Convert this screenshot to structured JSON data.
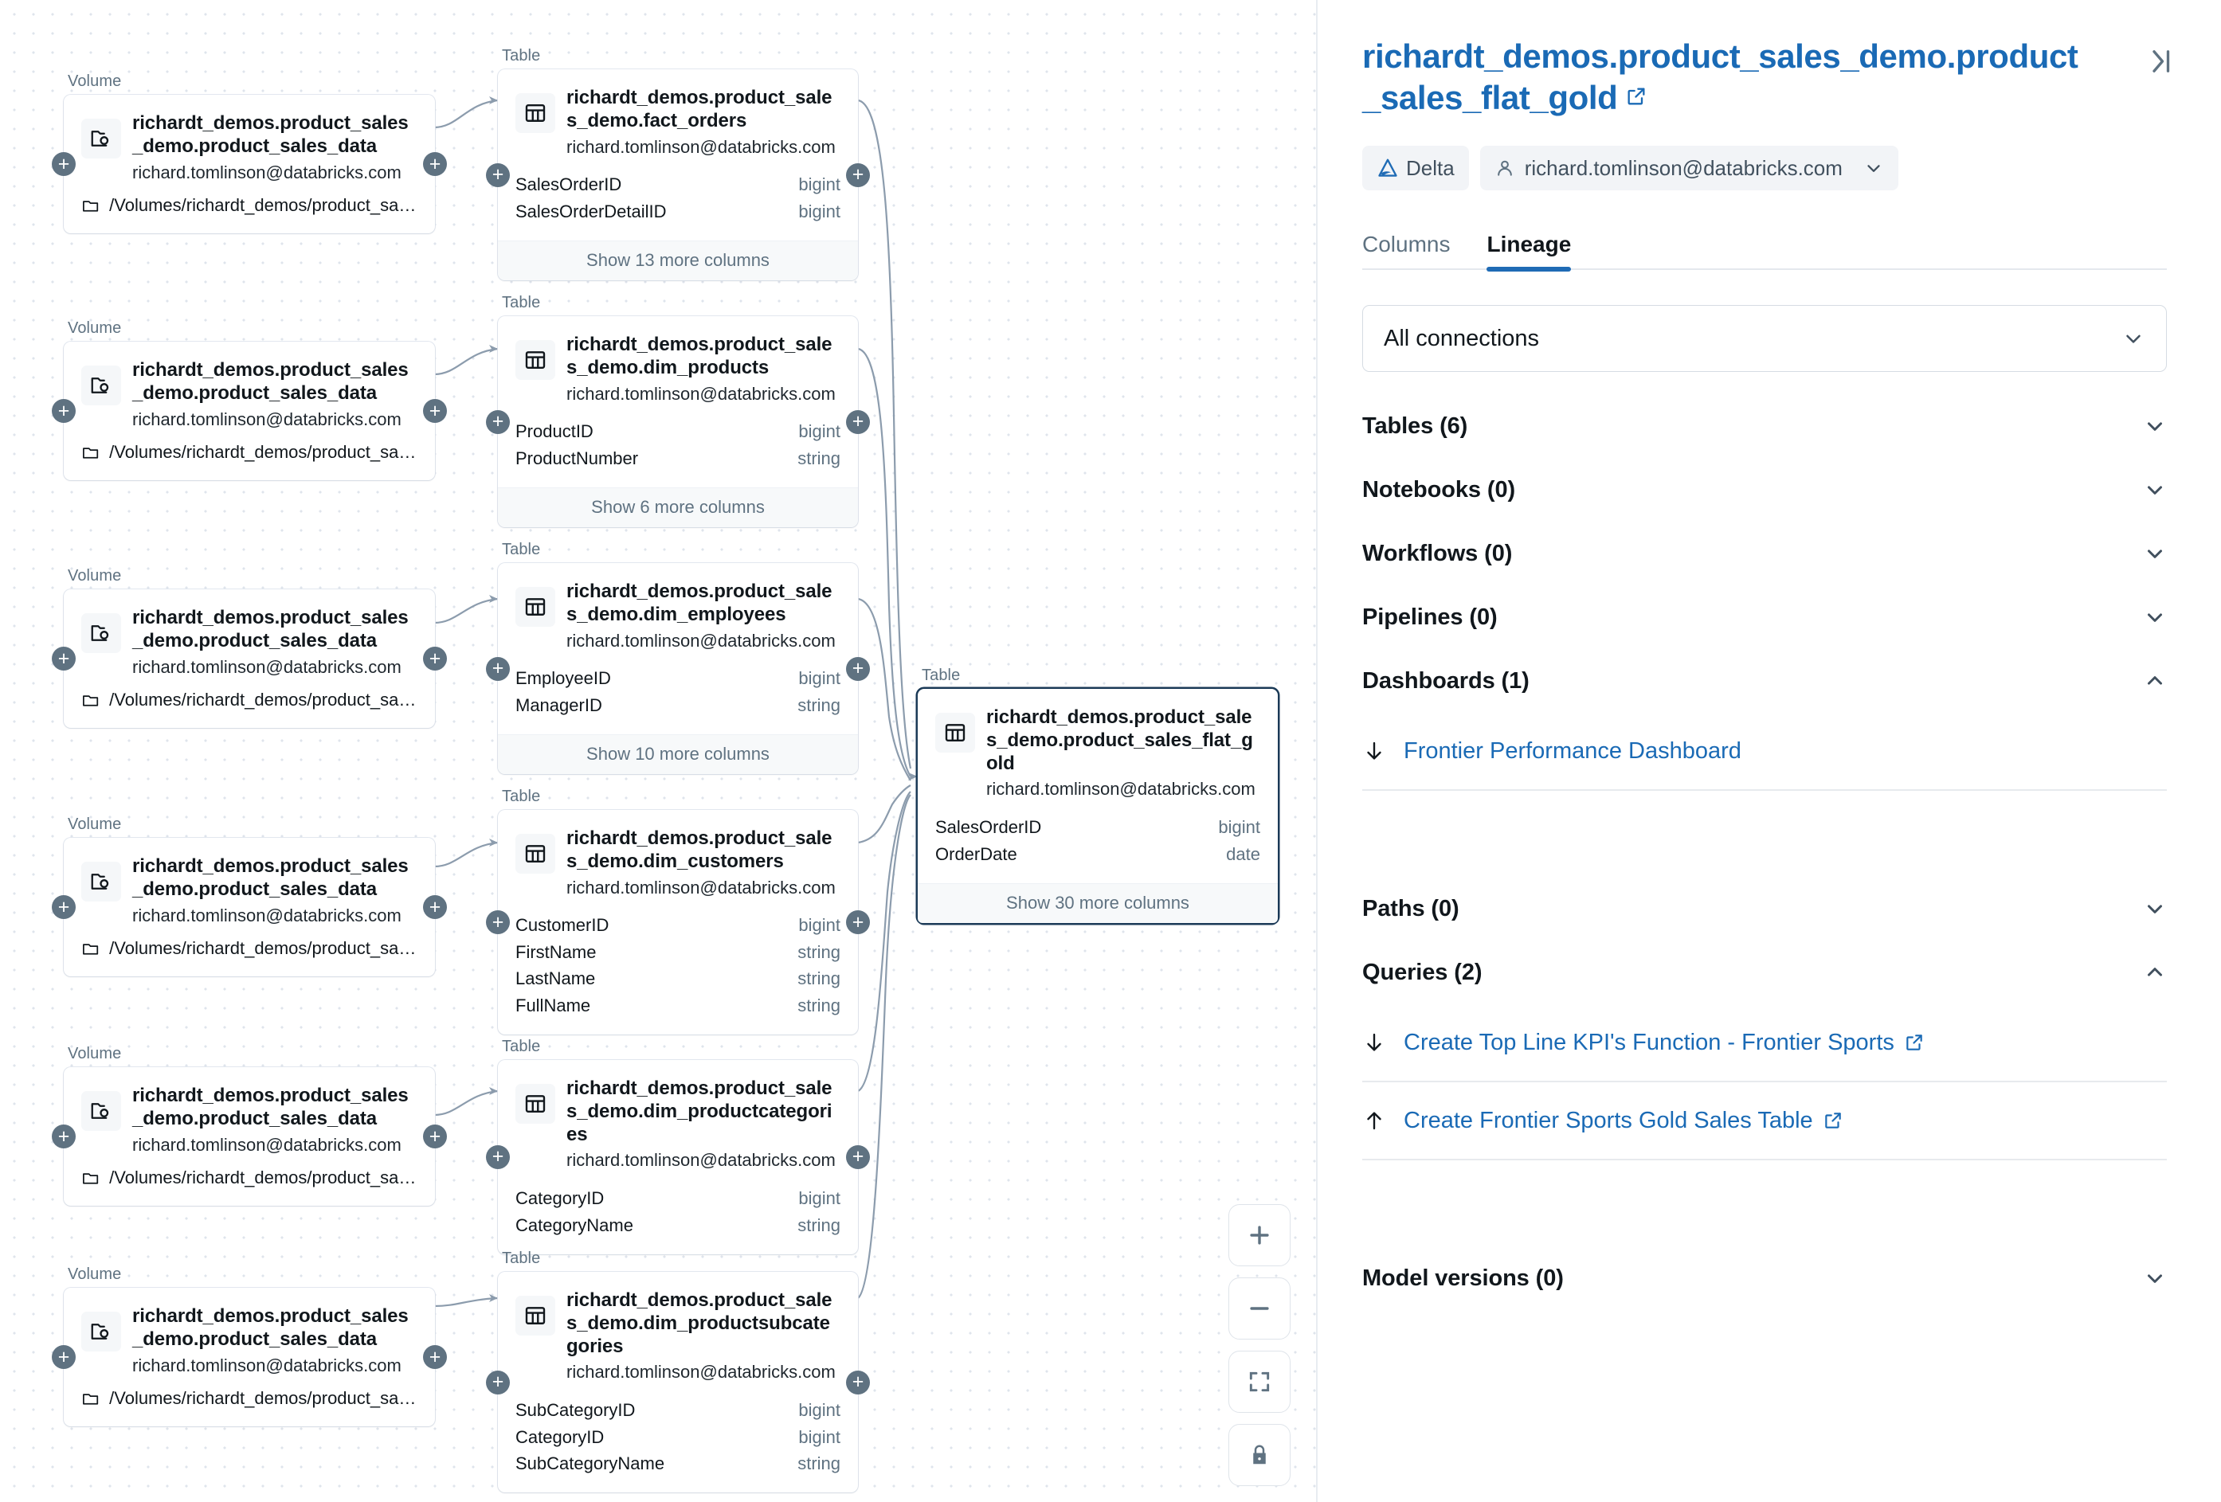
{
  "canvas": {
    "volume_type_label": "Volume",
    "table_type_label": "Table",
    "volume_node": {
      "title": "richardt_demos.product_sales_demo.product_sales_data",
      "owner": "richard.tomlinson@databricks.com",
      "path": "/Volumes/richardt_demos/product_sales_d..."
    },
    "tables": [
      {
        "title": "richardt_demos.product_sales_demo.fact_orders",
        "owner": "richard.tomlinson@databricks.com",
        "columns": [
          {
            "name": "SalesOrderID",
            "type": "bigint"
          },
          {
            "name": "SalesOrderDetailID",
            "type": "bigint"
          }
        ],
        "footer": "Show 13 more columns"
      },
      {
        "title": "richardt_demos.product_sales_demo.dim_products",
        "owner": "richard.tomlinson@databricks.com",
        "columns": [
          {
            "name": "ProductID",
            "type": "bigint"
          },
          {
            "name": "ProductNumber",
            "type": "string"
          }
        ],
        "footer": "Show 6 more columns"
      },
      {
        "title": "richardt_demos.product_sales_demo.dim_employees",
        "owner": "richard.tomlinson@databricks.com",
        "columns": [
          {
            "name": "EmployeeID",
            "type": "bigint"
          },
          {
            "name": "ManagerID",
            "type": "string"
          }
        ],
        "footer": "Show 10 more columns"
      },
      {
        "title": "richardt_demos.product_sales_demo.dim_customers",
        "owner": "richard.tomlinson@databricks.com",
        "columns": [
          {
            "name": "CustomerID",
            "type": "bigint"
          },
          {
            "name": "FirstName",
            "type": "string"
          },
          {
            "name": "LastName",
            "type": "string"
          },
          {
            "name": "FullName",
            "type": "string"
          }
        ],
        "footer": ""
      },
      {
        "title": "richardt_demos.product_sales_demo.dim_productcategories",
        "owner": "richard.tomlinson@databricks.com",
        "columns": [
          {
            "name": "CategoryID",
            "type": "bigint"
          },
          {
            "name": "CategoryName",
            "type": "string"
          }
        ],
        "footer": ""
      },
      {
        "title": "richardt_demos.product_sales_demo.dim_productsubcategories",
        "owner": "richard.tomlinson@databricks.com",
        "columns": [
          {
            "name": "SubCategoryID",
            "type": "bigint"
          },
          {
            "name": "CategoryID",
            "type": "bigint"
          },
          {
            "name": "SubCategoryName",
            "type": "string"
          }
        ],
        "footer": ""
      }
    ],
    "selected_table": {
      "title": "richardt_demos.product_sales_demo.product_sales_flat_gold",
      "owner": "richard.tomlinson@databricks.com",
      "columns": [
        {
          "name": "SalesOrderID",
          "type": "bigint"
        },
        {
          "name": "OrderDate",
          "type": "date"
        }
      ],
      "footer": "Show 30 more columns"
    },
    "zoom_controls": [
      {
        "name": "zoom-in-button",
        "icon": "plus-icon"
      },
      {
        "name": "zoom-out-button",
        "icon": "minus-icon"
      },
      {
        "name": "fit-view-button",
        "icon": "fit-screen-icon"
      },
      {
        "name": "lock-canvas-button",
        "icon": "lock-icon"
      }
    ]
  },
  "panel": {
    "title": "richardt_demos.product_sales_demo.product_sales_flat_gold",
    "format_badge": "Delta",
    "owner_badge": "richard.tomlinson@databricks.com",
    "tabs": [
      {
        "label": "Columns",
        "active": false
      },
      {
        "label": "Lineage",
        "active": true
      }
    ],
    "connection_filter": "All connections",
    "sections": [
      {
        "label": "Tables (6)",
        "expanded": false,
        "items": []
      },
      {
        "label": "Notebooks (0)",
        "expanded": false,
        "items": []
      },
      {
        "label": "Workflows (0)",
        "expanded": false,
        "items": []
      },
      {
        "label": "Pipelines (0)",
        "expanded": false,
        "items": []
      },
      {
        "label": "Dashboards (1)",
        "expanded": true,
        "items": [
          {
            "label": "Frontier Performance Dashboard",
            "direction": "down",
            "external": false
          }
        ]
      },
      {
        "label": "Paths (0)",
        "expanded": false,
        "items": []
      },
      {
        "label": "Queries (2)",
        "expanded": true,
        "items": [
          {
            "label": "Create Top Line KPI's Function - Frontier Sports",
            "direction": "down",
            "external": true
          },
          {
            "label": "Create Frontier Sports Gold Sales Table",
            "direction": "up",
            "external": true
          }
        ]
      },
      {
        "label": "Model versions (0)",
        "expanded": false,
        "items": []
      }
    ]
  },
  "colors": {
    "link": "#1a6ab5",
    "accent": "#1f6bb5",
    "muted": "#5f7281",
    "selected_border": "#1b3a57"
  }
}
